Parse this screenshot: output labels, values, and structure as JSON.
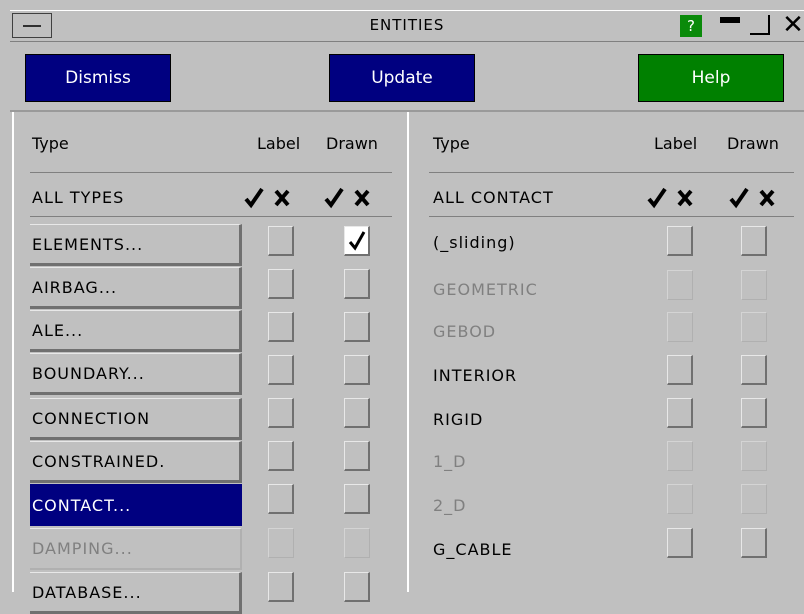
{
  "window": {
    "title": "ENTITIES",
    "help_q": "?"
  },
  "toolbar": {
    "dismiss": "Dismiss",
    "update": "Update",
    "help": "Help"
  },
  "left": {
    "headers": {
      "type": "Type",
      "label": "Label",
      "drawn": "Drawn"
    },
    "all_label": "ALL TYPES",
    "rows": [
      {
        "label": "ELEMENTS...",
        "drawn_checked": true
      },
      {
        "label": "AIRBAG..."
      },
      {
        "label": "ALE..."
      },
      {
        "label": "BOUNDARY..."
      },
      {
        "label": "CONNECTION"
      },
      {
        "label": "CONSTRAINED."
      },
      {
        "label": "CONTACT...",
        "selected": true
      },
      {
        "label": "DAMPING...",
        "disabled": true
      },
      {
        "label": "DATABASE..."
      }
    ]
  },
  "right": {
    "headers": {
      "type": "Type",
      "label": "Label",
      "drawn": "Drawn"
    },
    "all_label": "ALL CONTACT",
    "rows": [
      {
        "label": "(_sliding)"
      },
      {
        "label": "GEOMETRIC",
        "disabled": true
      },
      {
        "label": "GEBOD",
        "disabled": true
      },
      {
        "label": "INTERIOR"
      },
      {
        "label": "RIGID"
      },
      {
        "label": "1_D",
        "disabled": true
      },
      {
        "label": "2_D",
        "disabled": true
      },
      {
        "label": "G_CABLE"
      }
    ]
  },
  "colors": {
    "blue": "#000080",
    "green": "#008000",
    "bg": "#c0c0c0"
  }
}
